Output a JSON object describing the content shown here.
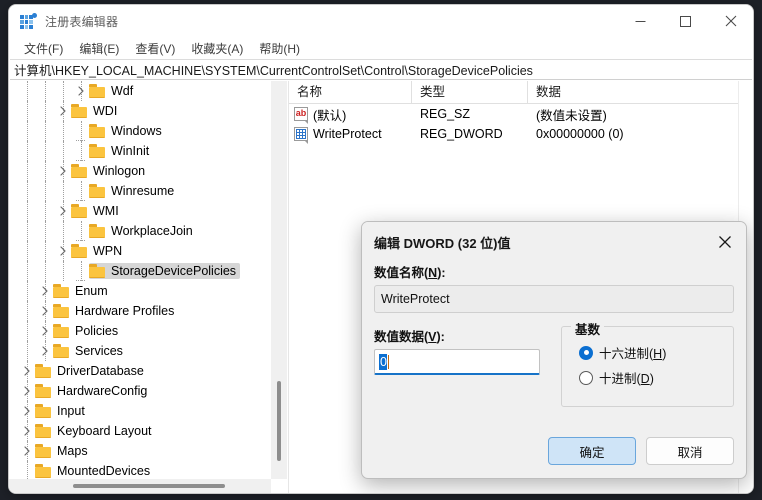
{
  "window": {
    "title": "注册表编辑器",
    "icon": "registry-icon",
    "controls": {
      "minimize": "−",
      "maximize": "□",
      "close": "✕"
    }
  },
  "menubar": {
    "items": [
      {
        "label": "文件(F)",
        "name": "menu-file"
      },
      {
        "label": "编辑(E)",
        "name": "menu-edit"
      },
      {
        "label": "查看(V)",
        "name": "menu-view"
      },
      {
        "label": "收藏夹(A)",
        "name": "menu-favorites"
      },
      {
        "label": "帮助(H)",
        "name": "menu-help"
      }
    ]
  },
  "address": {
    "path": "计算机\\HKEY_LOCAL_MACHINE\\SYSTEM\\CurrentControlSet\\Control\\StorageDevicePolicies"
  },
  "tree": {
    "items": [
      {
        "label": "Wdf",
        "indent": 3,
        "expandable": true,
        "selected": false
      },
      {
        "label": "WDI",
        "indent": 2,
        "expandable": true,
        "selected": false
      },
      {
        "label": "Windows",
        "indent": 3,
        "expandable": false,
        "selected": false
      },
      {
        "label": "WinInit",
        "indent": 3,
        "expandable": false,
        "selected": false
      },
      {
        "label": "Winlogon",
        "indent": 2,
        "expandable": true,
        "selected": false
      },
      {
        "label": "Winresume",
        "indent": 3,
        "expandable": false,
        "selected": false
      },
      {
        "label": "WMI",
        "indent": 2,
        "expandable": true,
        "selected": false
      },
      {
        "label": "WorkplaceJoin",
        "indent": 3,
        "expandable": false,
        "selected": false
      },
      {
        "label": "WPN",
        "indent": 2,
        "expandable": true,
        "selected": false
      },
      {
        "label": "StorageDevicePolicies",
        "indent": 3,
        "expandable": false,
        "selected": true
      },
      {
        "label": "Enum",
        "indent": 1,
        "expandable": true,
        "selected": false
      },
      {
        "label": "Hardware Profiles",
        "indent": 1,
        "expandable": true,
        "selected": false
      },
      {
        "label": "Policies",
        "indent": 1,
        "expandable": true,
        "selected": false
      },
      {
        "label": "Services",
        "indent": 1,
        "expandable": true,
        "selected": false
      },
      {
        "label": "DriverDatabase",
        "indent": 0,
        "expandable": true,
        "selected": false
      },
      {
        "label": "HardwareConfig",
        "indent": 0,
        "expandable": true,
        "selected": false
      },
      {
        "label": "Input",
        "indent": 0,
        "expandable": true,
        "selected": false
      },
      {
        "label": "Keyboard Layout",
        "indent": 0,
        "expandable": true,
        "selected": false
      },
      {
        "label": "Maps",
        "indent": 0,
        "expandable": true,
        "selected": false
      },
      {
        "label": "MountedDevices",
        "indent": 0,
        "expandable": false,
        "selected": false
      }
    ]
  },
  "values": {
    "columns": [
      "名称",
      "类型",
      "数据"
    ],
    "rows": [
      {
        "icon": "string-value-icon",
        "name": "(默认)",
        "type": "REG_SZ",
        "data": "(数值未设置)"
      },
      {
        "icon": "dword-value-icon",
        "name": "WriteProtect",
        "type": "REG_DWORD",
        "data": "0x00000000 (0)"
      }
    ]
  },
  "dialog": {
    "title": "编辑 DWORD (32 位)值",
    "close_label": "✕",
    "name_label_pre": "数值名称(",
    "name_label_key": "N",
    "name_label_post": "):",
    "name_value": "WriteProtect",
    "data_label_pre": "数值数据(",
    "data_label_key": "V",
    "data_label_post": "):",
    "data_value": "0",
    "base_legend": "基数",
    "radios": [
      {
        "label_pre": "十六进制(",
        "key": "H",
        "label_post": ")",
        "selected": true
      },
      {
        "label_pre": "十进制(",
        "key": "D",
        "label_post": ")",
        "selected": false
      }
    ],
    "ok_label": "确定",
    "cancel_label": "取消"
  },
  "colors": {
    "accent": "#0b6fd1",
    "folder": "#fbc43f",
    "selection": "#d6d6d6",
    "desktop": "#1e2128"
  }
}
